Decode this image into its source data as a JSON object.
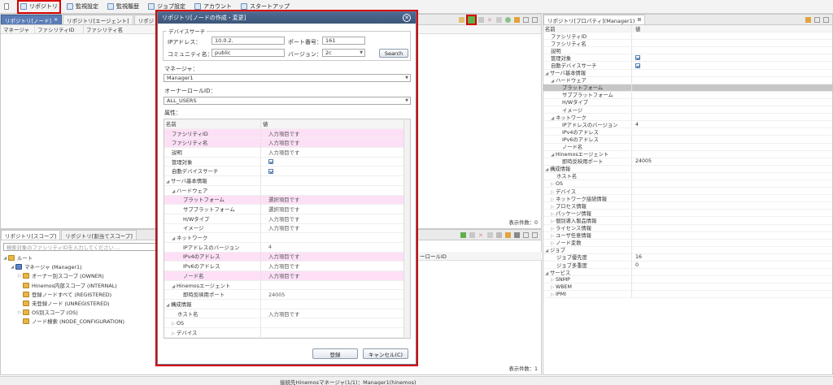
{
  "toolbar": {
    "items": [
      {
        "label": "",
        "icon": "view-menu-icon"
      },
      {
        "label": "リポジトリ",
        "icon": "repository-icon"
      },
      {
        "label": "監視設定",
        "icon": "monitor-setting-icon"
      },
      {
        "label": "監視履歴",
        "icon": "monitor-history-icon"
      },
      {
        "label": "ジョブ設定",
        "icon": "job-setting-icon"
      },
      {
        "label": "アカウント",
        "icon": "account-icon"
      },
      {
        "label": "スタートアップ",
        "icon": "startup-icon"
      }
    ]
  },
  "node_view": {
    "tabs": [
      "リポジトリ[ノード]",
      "リポジトリ[エージェント]",
      "リポジトリ["
    ],
    "columns": [
      "マネージャ",
      "ファシリティID",
      "ファシリティ名"
    ],
    "count_label": "表示件数：0"
  },
  "hidden_col": {
    "label": "ーロールID"
  },
  "scope_view": {
    "tabs": [
      "リポジトリ[スコープ]",
      "リポジトリ[割当てスコープ]"
    ],
    "search_placeholder": "検索対象のファシリティIDを入力してください ...",
    "tree": [
      {
        "label": "ルート",
        "level": 0
      },
      {
        "label": "マネージャ (Manager1)",
        "level": 1
      },
      {
        "label": "オーナー別スコープ (OWNER)",
        "level": 2
      },
      {
        "label": "Hinemos内部スコープ (INTERNAL)",
        "level": 2
      },
      {
        "label": "登録ノードすべて (REGISTERED)",
        "level": 2
      },
      {
        "label": "未登録ノード (UNREGISTERED)",
        "level": 2
      },
      {
        "label": "OS別スコープ (OS)",
        "level": 2
      },
      {
        "label": "ノード検索 (NODE_CONFIGURATION)",
        "level": 2
      }
    ],
    "count_label": "表示件数：1"
  },
  "props_view": {
    "tab": "リポジトリ[プロパティ](Manager1)",
    "col_name": "名前",
    "col_value": "値",
    "rows": [
      {
        "name": "ファシリティID",
        "value": "",
        "indent": 1,
        "hl": false,
        "check": false,
        "arrow": ""
      },
      {
        "name": "ファシリティ名",
        "value": "",
        "indent": 1,
        "hl": false,
        "check": false,
        "arrow": ""
      },
      {
        "name": "説明",
        "value": "",
        "indent": 1,
        "hl": false,
        "check": false,
        "arrow": ""
      },
      {
        "name": "管理対象",
        "value": "",
        "indent": 1,
        "hl": false,
        "check": true,
        "arrow": ""
      },
      {
        "name": "自動デバイスサーチ",
        "value": "",
        "indent": 1,
        "hl": false,
        "check": true,
        "arrow": ""
      },
      {
        "name": "サーバ基本情報",
        "value": "",
        "indent": 0,
        "hl": false,
        "check": false,
        "arrow": "◢"
      },
      {
        "name": "ハードウェア",
        "value": "",
        "indent": 1,
        "hl": false,
        "check": false,
        "arrow": "◢"
      },
      {
        "name": "プラットフォーム",
        "value": "",
        "indent": 3,
        "hl": true,
        "check": false,
        "arrow": ""
      },
      {
        "name": "サブプラットフォーム",
        "value": "",
        "indent": 3,
        "hl": false,
        "check": false,
        "arrow": ""
      },
      {
        "name": "H/Wタイプ",
        "value": "",
        "indent": 3,
        "hl": false,
        "check": false,
        "arrow": ""
      },
      {
        "name": "イメージ",
        "value": "",
        "indent": 3,
        "hl": false,
        "check": false,
        "arrow": ""
      },
      {
        "name": "ネットワーク",
        "value": "",
        "indent": 1,
        "hl": false,
        "check": false,
        "arrow": "◢"
      },
      {
        "name": "IPアドレスのバージョン",
        "value": "4",
        "indent": 3,
        "hl": false,
        "check": false,
        "arrow": ""
      },
      {
        "name": "IPv4のアドレス",
        "value": "",
        "indent": 3,
        "hl": false,
        "check": false,
        "arrow": ""
      },
      {
        "name": "IPv6のアドレス",
        "value": "",
        "indent": 3,
        "hl": false,
        "check": false,
        "arrow": ""
      },
      {
        "name": "ノード名",
        "value": "",
        "indent": 3,
        "hl": false,
        "check": false,
        "arrow": ""
      },
      {
        "name": "Hinemosエージェント",
        "value": "",
        "indent": 1,
        "hl": false,
        "check": false,
        "arrow": "◢"
      },
      {
        "name": "即時反映用ポート",
        "value": "24005",
        "indent": 3,
        "hl": false,
        "check": false,
        "arrow": ""
      },
      {
        "name": "構成情報",
        "value": "",
        "indent": 0,
        "hl": false,
        "check": false,
        "arrow": "◢"
      },
      {
        "name": "ホスト名",
        "value": "",
        "indent": 2,
        "hl": false,
        "check": false,
        "arrow": ""
      },
      {
        "name": "OS",
        "value": "",
        "indent": 1,
        "hl": false,
        "check": false,
        "arrow": "▷"
      },
      {
        "name": "デバイス",
        "value": "",
        "indent": 1,
        "hl": false,
        "check": false,
        "arrow": "▷"
      },
      {
        "name": "ネットワーク接続情報",
        "value": "",
        "indent": 1,
        "hl": false,
        "check": false,
        "arrow": "▷"
      },
      {
        "name": "プロセス情報",
        "value": "",
        "indent": 1,
        "hl": false,
        "check": false,
        "arrow": "▷"
      },
      {
        "name": "パッケージ情報",
        "value": "",
        "indent": 1,
        "hl": false,
        "check": false,
        "arrow": "▷"
      },
      {
        "name": "個別導入製品情報",
        "value": "",
        "indent": 1,
        "hl": false,
        "check": false,
        "arrow": "▷"
      },
      {
        "name": "ライセンス情報",
        "value": "",
        "indent": 1,
        "hl": false,
        "check": false,
        "arrow": "▷"
      },
      {
        "name": "ユーザ任意情報",
        "value": "",
        "indent": 1,
        "hl": false,
        "check": false,
        "arrow": "▷"
      },
      {
        "name": "ノード変数",
        "value": "",
        "indent": 1,
        "hl": false,
        "check": false,
        "arrow": "▷"
      },
      {
        "name": "ジョブ",
        "value": "",
        "indent": 0,
        "hl": false,
        "check": false,
        "arrow": "◢"
      },
      {
        "name": "ジョブ優先度",
        "value": "16",
        "indent": 2,
        "hl": false,
        "check": false,
        "arrow": ""
      },
      {
        "name": "ジョブ多重度",
        "value": "0",
        "indent": 2,
        "hl": false,
        "check": false,
        "arrow": ""
      },
      {
        "name": "サービス",
        "value": "",
        "indent": 0,
        "hl": false,
        "check": false,
        "arrow": "◢"
      },
      {
        "name": "SNMP",
        "value": "",
        "indent": 1,
        "hl": false,
        "check": false,
        "arrow": "▷"
      },
      {
        "name": "WBEM",
        "value": "",
        "indent": 1,
        "hl": false,
        "check": false,
        "arrow": "▷"
      },
      {
        "name": "IPMI",
        "value": "",
        "indent": 1,
        "hl": false,
        "check": false,
        "arrow": "▷"
      }
    ]
  },
  "dialog": {
    "title": "リポジトリ[ノードの作成・変更]",
    "device_search": {
      "legend": "デバイスサーチ",
      "ip_label": "IPアドレス：",
      "ip_value": "10.0.2.",
      "port_label": "ポート番号：",
      "port_value": "161",
      "community_label": "コミュニティ名：",
      "community_value": "public",
      "version_label": "バージョン：",
      "version_value": "2c",
      "search_label": "Search"
    },
    "manager_label": "マネージャ：",
    "manager_value": "Manager1",
    "owner_label": "オーナーロールID：",
    "owner_value": "ALL_USERS",
    "attr_label": "属性：",
    "col_name": "名前",
    "col_value": "値",
    "rows": [
      {
        "name": "ファシリティID",
        "value": "入力項目です",
        "indent": 1,
        "pink": true,
        "check": false,
        "arrow": ""
      },
      {
        "name": "ファシリティ名",
        "value": "入力項目です",
        "indent": 1,
        "pink": true,
        "check": false,
        "arrow": ""
      },
      {
        "name": "説明",
        "value": "入力項目です",
        "indent": 1,
        "pink": false,
        "check": false,
        "arrow": ""
      },
      {
        "name": "管理対象",
        "value": "",
        "indent": 1,
        "pink": false,
        "check": true,
        "arrow": ""
      },
      {
        "name": "自動デバイスサーチ",
        "value": "",
        "indent": 1,
        "pink": false,
        "check": true,
        "arrow": ""
      },
      {
        "name": "サーバ基本情報",
        "value": "",
        "indent": 0,
        "pink": false,
        "check": false,
        "arrow": "◢"
      },
      {
        "name": "ハードウェア",
        "value": "",
        "indent": 1,
        "pink": false,
        "check": false,
        "arrow": "◢"
      },
      {
        "name": "プラットフォーム",
        "value": "選択項目です",
        "indent": 3,
        "pink": true,
        "check": false,
        "arrow": ""
      },
      {
        "name": "サブプラットフォーム",
        "value": "選択項目です",
        "indent": 3,
        "pink": false,
        "check": false,
        "arrow": ""
      },
      {
        "name": "H/Wタイプ",
        "value": "入力項目です",
        "indent": 3,
        "pink": false,
        "check": false,
        "arrow": ""
      },
      {
        "name": "イメージ",
        "value": "入力項目です",
        "indent": 3,
        "pink": false,
        "check": false,
        "arrow": ""
      },
      {
        "name": "ネットワーク",
        "value": "",
        "indent": 1,
        "pink": false,
        "check": false,
        "arrow": "◢"
      },
      {
        "name": "IPアドレスのバージョン",
        "value": "4",
        "indent": 3,
        "pink": false,
        "check": false,
        "arrow": ""
      },
      {
        "name": "IPv4のアドレス",
        "value": "入力項目です",
        "indent": 3,
        "pink": true,
        "check": false,
        "arrow": ""
      },
      {
        "name": "IPv6のアドレス",
        "value": "入力項目です",
        "indent": 3,
        "pink": false,
        "check": false,
        "arrow": ""
      },
      {
        "name": "ノード名",
        "value": "入力項目です",
        "indent": 3,
        "pink": true,
        "check": false,
        "arrow": ""
      },
      {
        "name": "Hinemosエージェント",
        "value": "",
        "indent": 1,
        "pink": false,
        "check": false,
        "arrow": "◢"
      },
      {
        "name": "即時反映用ポート",
        "value": "24005",
        "indent": 3,
        "pink": false,
        "check": false,
        "arrow": ""
      },
      {
        "name": "構成情報",
        "value": "",
        "indent": 0,
        "pink": false,
        "check": false,
        "arrow": "◢"
      },
      {
        "name": "ホスト名",
        "value": "入力項目です",
        "indent": 2,
        "pink": false,
        "check": false,
        "arrow": ""
      },
      {
        "name": "OS",
        "value": "",
        "indent": 1,
        "pink": false,
        "check": false,
        "arrow": "▷"
      },
      {
        "name": "デバイス",
        "value": "",
        "indent": 1,
        "pink": false,
        "check": false,
        "arrow": "▷"
      }
    ],
    "register_label": "登録",
    "cancel_label": "キャンセル(C)"
  },
  "statusbar": {
    "text": "接続先Hinemosマネージャ(1/1)：Manager1(hinemos)"
  },
  "colors": {
    "highlight": "#d60000",
    "pink": "#fde0f6",
    "title_bar": "#3c5678",
    "selected_row": "#c6c6c6"
  }
}
